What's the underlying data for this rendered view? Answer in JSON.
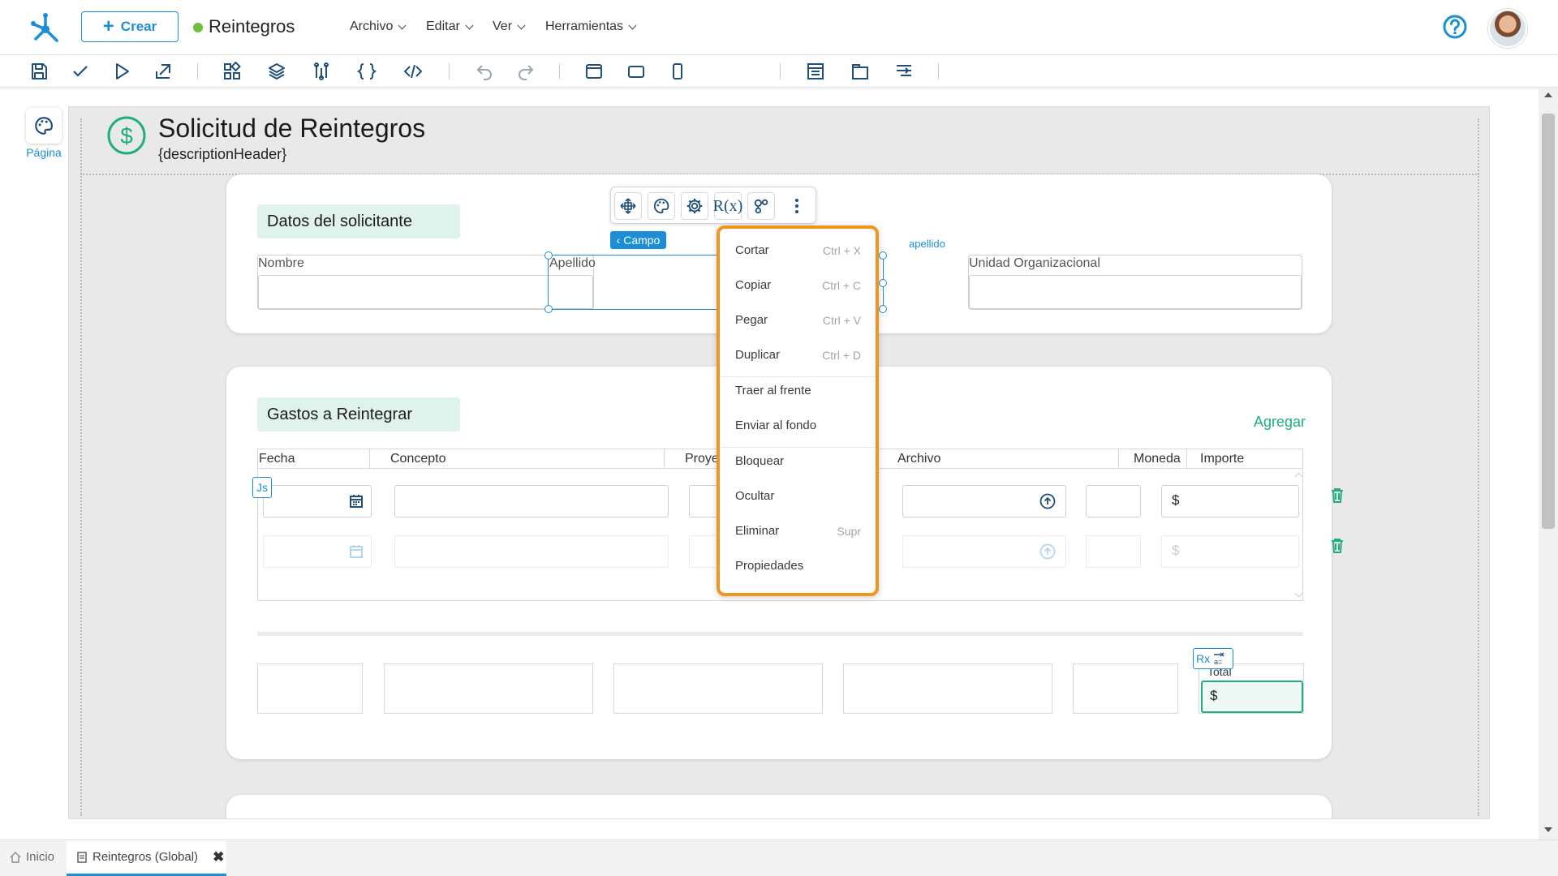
{
  "header": {
    "create_label": "Crear",
    "app_title": "Reintegros",
    "menus": [
      "Archivo",
      "Editar",
      "Ver",
      "Herramientas"
    ]
  },
  "toolbar": {
    "width_label": "1382px"
  },
  "side": {
    "page_label": "Página"
  },
  "form": {
    "title": "Solicitud de Reintegros",
    "description": "{descriptionHeader}"
  },
  "section1": {
    "title": "Datos del solicitante",
    "fields": [
      "Nombre",
      "Apellido",
      "Unidad Organizacional"
    ]
  },
  "field_toolbar": {
    "campo_tag": "Campo",
    "apellido_tag": "apellido",
    "rx_label": "R(x)"
  },
  "section2": {
    "title": "Gastos a Reintegrar",
    "add_label": "Agregar",
    "columns": [
      "Fecha",
      "Concepto",
      "Proye",
      "Archivo",
      "Moneda",
      "Importe"
    ],
    "js_badge": "Js",
    "currency_symbol": "$",
    "total_label": "Total",
    "total_value": "$",
    "rx_badge": "Rx"
  },
  "context_menu": {
    "items": [
      {
        "label": "Cortar",
        "shortcut": "Ctrl + X"
      },
      {
        "label": "Copiar",
        "shortcut": "Ctrl + C"
      },
      {
        "label": "Pegar",
        "shortcut": "Ctrl + V"
      },
      {
        "label": "Duplicar",
        "shortcut": "Ctrl + D"
      },
      {
        "label": "Traer al frente",
        "shortcut": ""
      },
      {
        "label": "Enviar al fondo",
        "shortcut": ""
      },
      {
        "label": "Bloquear",
        "shortcut": ""
      },
      {
        "label": "Ocultar",
        "shortcut": ""
      },
      {
        "label": "Eliminar",
        "shortcut": "Supr"
      },
      {
        "label": "Propiedades",
        "shortcut": ""
      }
    ]
  },
  "bottom_tabs": {
    "home": "Inicio",
    "active": "Reintegros (Global)"
  },
  "colors": {
    "primary": "#1a8fd6",
    "accent_green": "#1fae7e",
    "menu_border": "#f0961e"
  }
}
